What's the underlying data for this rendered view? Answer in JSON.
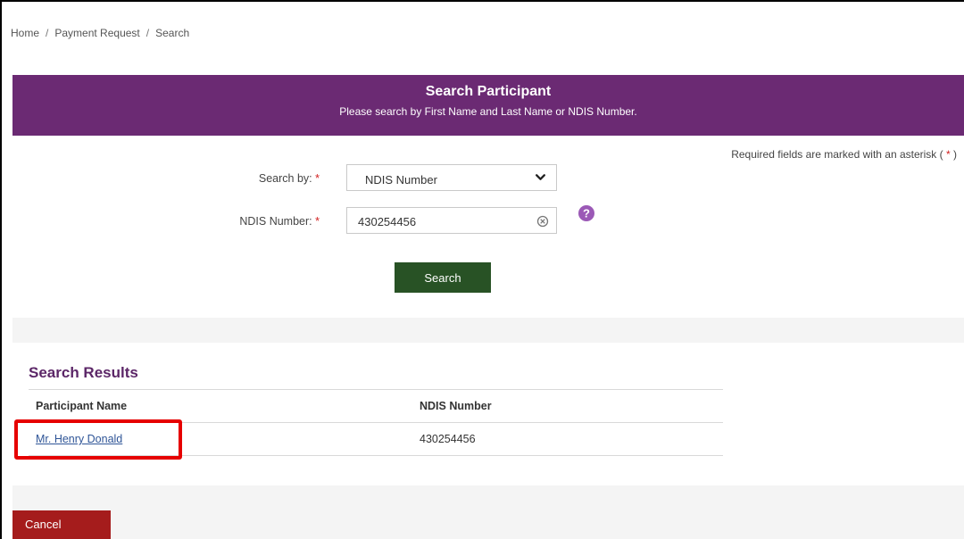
{
  "breadcrumb": {
    "items": [
      "Home",
      "Payment Request",
      "Search"
    ],
    "separator": "/"
  },
  "header": {
    "title": "Search Participant",
    "subtitle": "Please search by First Name and Last Name or NDIS Number."
  },
  "form": {
    "required_note_prefix": "Required fields are marked with an asterisk (",
    "required_note_star": "*",
    "required_note_suffix": ")",
    "search_by_label": "Search by:",
    "search_by_value": "NDIS Number",
    "ndis_label": "NDIS Number:",
    "ndis_value": "430254456",
    "required_star": "*",
    "search_button": "Search"
  },
  "results": {
    "title": "Search Results",
    "columns": [
      "Participant Name",
      "NDIS Number"
    ],
    "rows": [
      {
        "name": "Mr. Henry Donald",
        "ndis": "430254456"
      }
    ]
  },
  "footer": {
    "cancel_button": "Cancel"
  },
  "colors": {
    "banner": "#6b2a73",
    "search_button": "#285225",
    "cancel_button": "#a51c1c",
    "required_star": "#d21f1f",
    "highlight": "#e60000"
  },
  "icons": {
    "select_chevron": "chevron-down-icon",
    "clear_field": "clear-icon",
    "help": "help-icon"
  }
}
